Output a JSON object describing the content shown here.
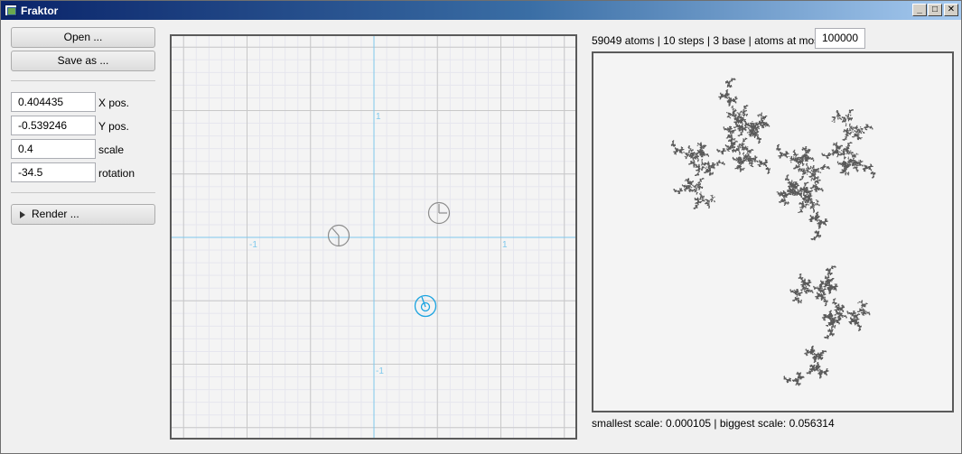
{
  "window": {
    "title": "Fraktor",
    "minimize_glyph": "_",
    "maximize_glyph": "□",
    "close_glyph": "✕"
  },
  "left_panel": {
    "open_label": "Open ...",
    "save_label": "Save as ...",
    "x_pos": {
      "value": "0.404435",
      "label": "X pos."
    },
    "y_pos": {
      "value": "-0.539246",
      "label": "Y pos."
    },
    "scale": {
      "value": "0.4",
      "label": "scale"
    },
    "rotation": {
      "value": "-34.5",
      "label": "rotation"
    },
    "render_label": "Render ..."
  },
  "editor": {
    "axis_labels": {
      "y_pos": "1",
      "x_neg": "-1",
      "x_pos": "1",
      "y_neg": "-1"
    },
    "colors": {
      "axis": "#7ec8ec",
      "grid": "#c8c8c8",
      "selected": "#1aa3e0",
      "handle": "#8c8c8c"
    }
  },
  "preview": {
    "status_text": "59049 atoms | 10 steps | 3 base | atoms at most:",
    "max_atoms": "100000",
    "scale_text": "smallest scale: 0.000105 | biggest scale: 0.056314",
    "atom_color": "#5a5a5a"
  }
}
